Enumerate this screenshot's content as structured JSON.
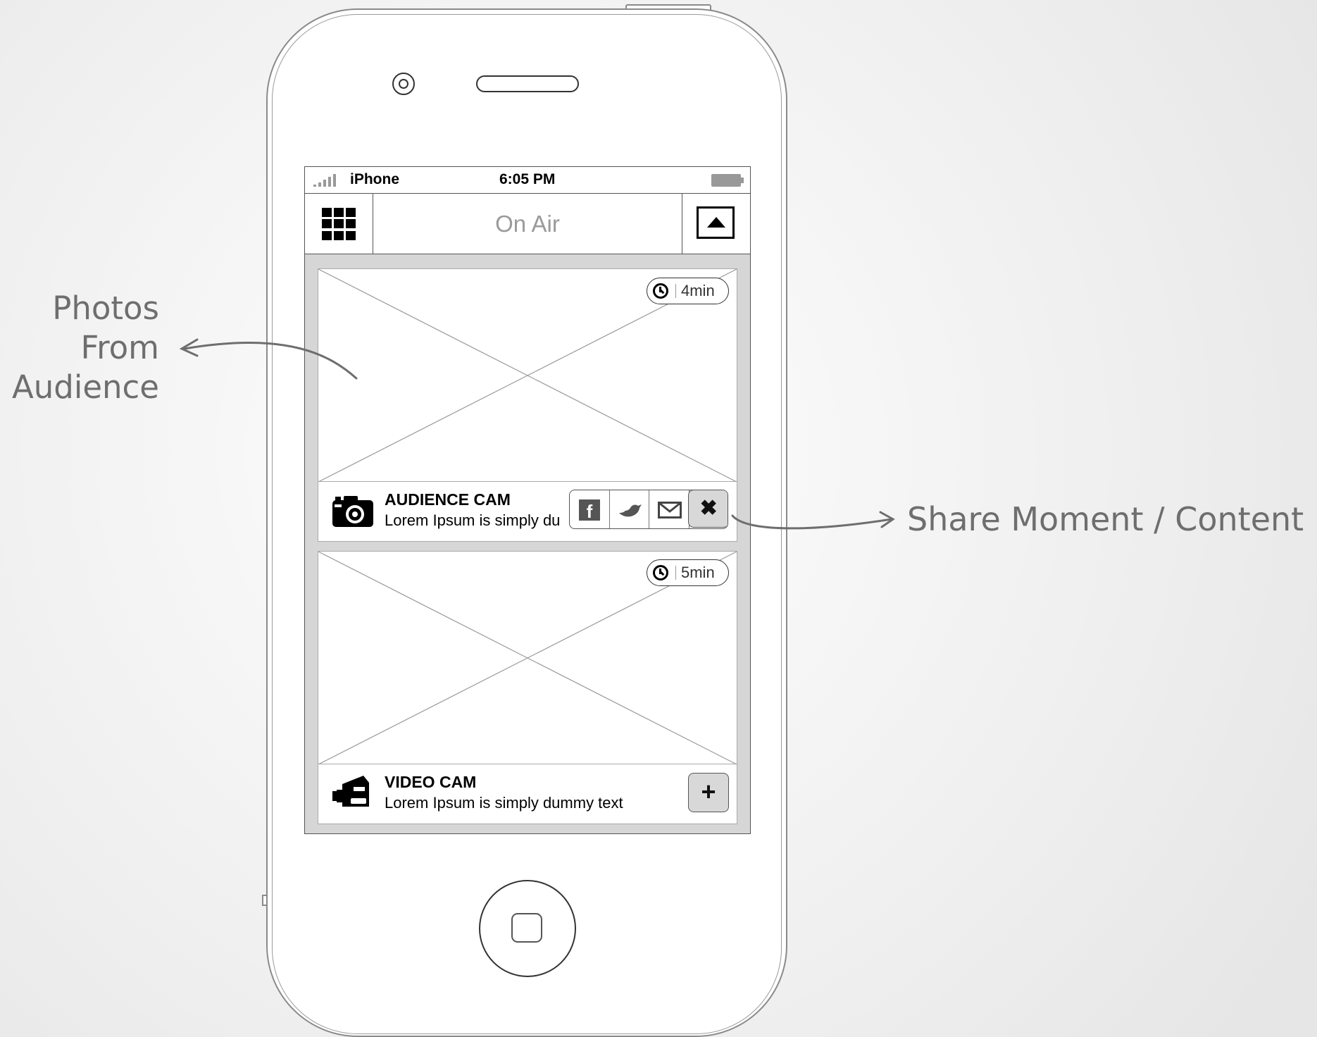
{
  "statusbar": {
    "carrier": "iPhone",
    "time": "6:05 PM",
    "signal_icon": "signal-bars-icon",
    "battery_icon": "battery-icon"
  },
  "navbar": {
    "title": "On Air",
    "menu_icon": "grid-menu-icon",
    "airplay_icon": "airplay-icon"
  },
  "cards": [
    {
      "time": "4min",
      "title": "AUDIENCE CAM",
      "description": "Lorem Ipsum is simply du",
      "type_icon": "camera-icon",
      "share_options": [
        "facebook-icon",
        "twitter-icon",
        "mail-icon"
      ],
      "close_label": "✖"
    },
    {
      "time": "5min",
      "title": "VIDEO CAM",
      "description": "Lorem Ipsum is simply dummy text",
      "type_icon": "video-camera-icon",
      "action_label": "+"
    }
  ],
  "annotations": {
    "left": [
      "Photos",
      "From",
      "Audience"
    ],
    "right": "Share Moment / Content"
  },
  "colors": {
    "annotation": "#6e6e6e",
    "title_gray": "#9a9a9a",
    "screen_bg": "#d6d6d6"
  }
}
